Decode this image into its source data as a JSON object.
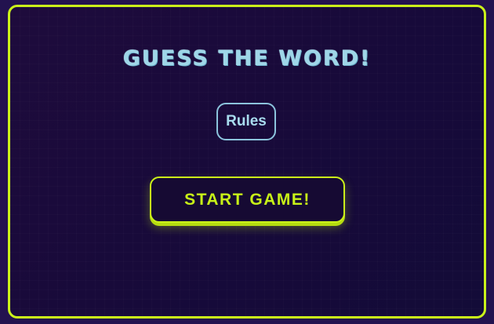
{
  "game": {
    "title": "GUESS THE WORD!",
    "rules_label": "Rules",
    "start_label": "START GAME!"
  },
  "colors": {
    "background": "#23124f",
    "panel": "#170a3a",
    "accent_border": "#cbf21a",
    "title_text": "#9fd6e8",
    "rules_border": "#8cc4dd",
    "start_text": "#c8f218"
  }
}
